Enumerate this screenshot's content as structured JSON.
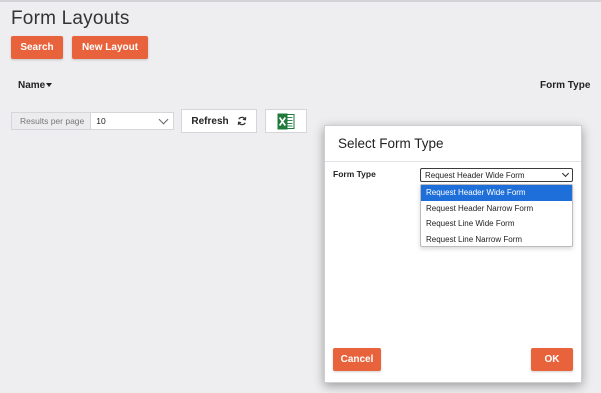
{
  "page": {
    "title": "Form Layouts"
  },
  "toolbar": {
    "search_label": "Search",
    "new_layout_label": "New Layout"
  },
  "table": {
    "columns": [
      "Name",
      "Form Type"
    ]
  },
  "pagination": {
    "results_per_page_label": "Results per page",
    "results_per_page_value": "10"
  },
  "actions": {
    "refresh_label": "Refresh",
    "export_icon": "excel-icon"
  },
  "colors": {
    "accent": "#e8623c",
    "dropdown_selected": "#1e6fd9",
    "excel_green": "#1f7a3c"
  },
  "modal": {
    "title": "Select Form Type",
    "form_type_label": "Form Type",
    "form_type_value": "Request Header Wide Form",
    "options": [
      "Request Header Wide Form",
      "Request Header Narrow Form",
      "Request Line Wide Form",
      "Request Line Narrow Form"
    ],
    "selected_index": 0,
    "cancel_label": "Cancel",
    "ok_label": "OK"
  }
}
